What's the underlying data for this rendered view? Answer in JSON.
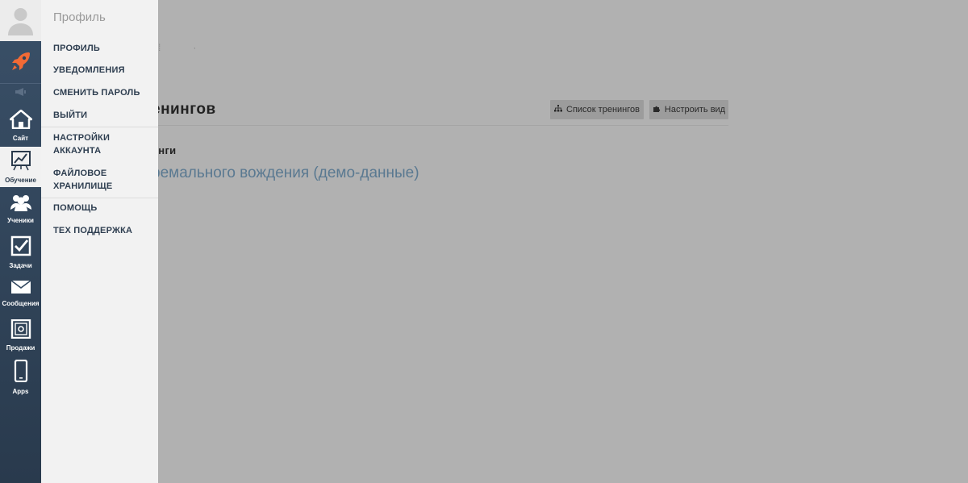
{
  "background": {
    "page_title": "енингов",
    "section_title": "инги",
    "training_link": "ремального вождения (демо-данные)",
    "buttons": {
      "list": "Список тренингов",
      "configure": "Настроить вид"
    }
  },
  "rail": {
    "items": [
      {
        "label": "",
        "icon": "rocket-icon"
      },
      {
        "label": "",
        "icon": "megaphone-icon"
      },
      {
        "label": "Сайт",
        "icon": "home-icon"
      },
      {
        "label": "Обучение",
        "icon": "chart-easel-icon"
      },
      {
        "label": "Ученики",
        "icon": "users-icon"
      },
      {
        "label": "Задачи",
        "icon": "checkbox-icon"
      },
      {
        "label": "Сообщения",
        "icon": "envelope-icon"
      },
      {
        "label": "Продажи",
        "icon": "safe-icon"
      },
      {
        "label": "Apps",
        "icon": "phone-icon"
      }
    ],
    "accent_color": "#f26a35"
  },
  "profile_menu": {
    "title": "Профиль",
    "items": [
      "ПРОФИЛЬ",
      "УВЕДОМЛЕНИЯ",
      "СМЕНИТЬ ПАРОЛЬ",
      "ВЫЙТИ",
      "НАСТРОЙКИ АККАУНТА",
      "ФАЙЛОВОЕ ХРАНИЛИЩЕ",
      "ПОМОЩЬ",
      "ТЕХ ПОДДЕРЖКА"
    ]
  }
}
